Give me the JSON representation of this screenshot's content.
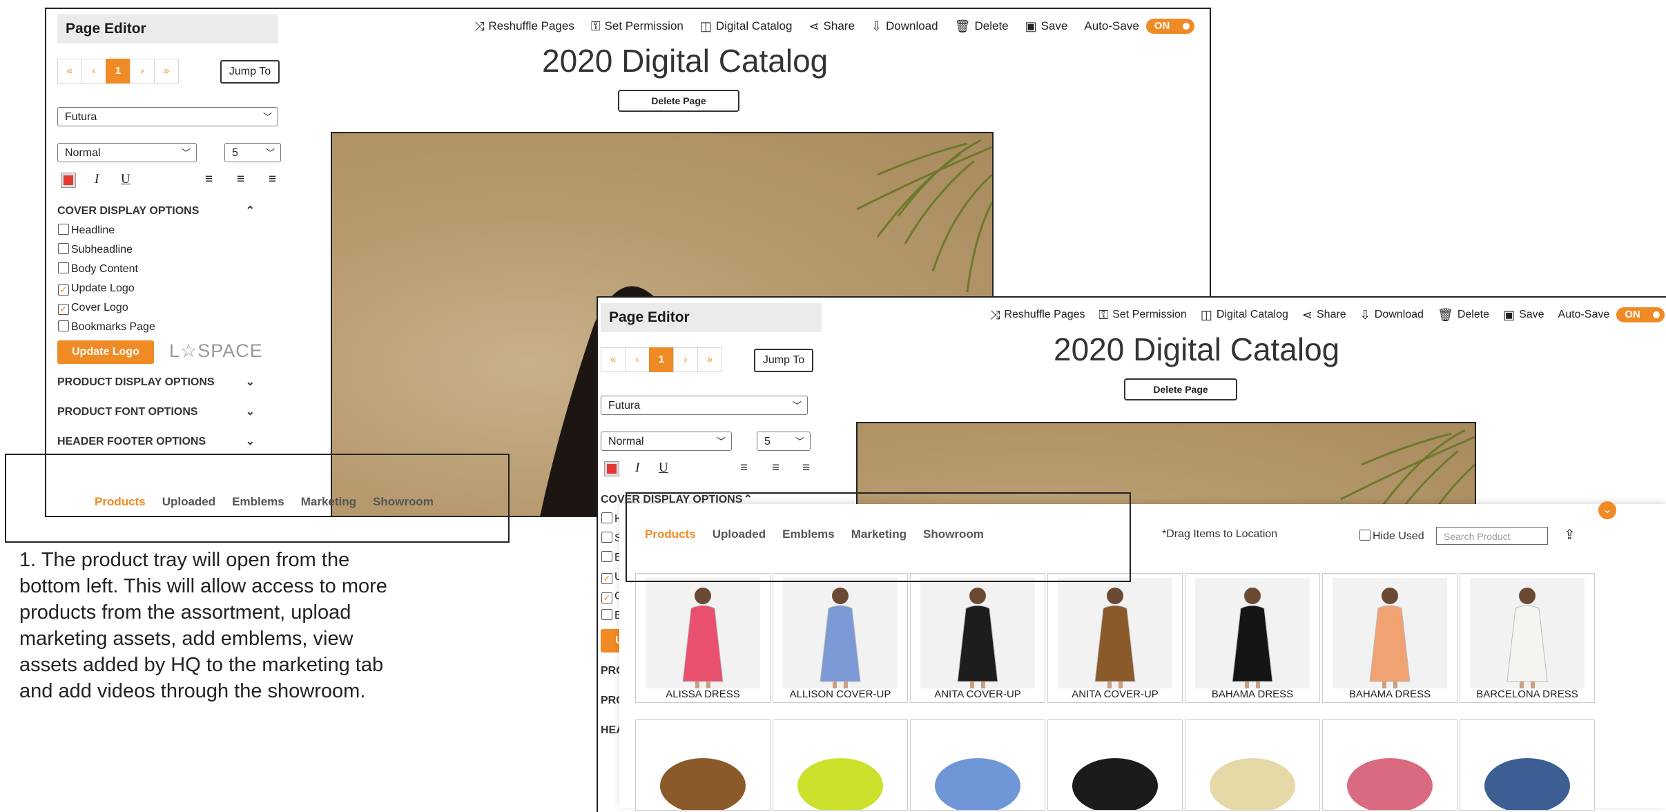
{
  "editor": {
    "sidebar_title": "Page Editor",
    "pager": [
      "«",
      "‹",
      "1",
      "›",
      "»"
    ],
    "jump_label": "Jump To",
    "font_value": "Futura",
    "style_value": "Normal",
    "size_value": "5",
    "sections": {
      "cover": "COVER DISPLAY OPTIONS",
      "product": "PRODUCT DISPLAY OPTIONS",
      "font": "PRODUCT FONT OPTIONS",
      "header": "HEADER FOOTER OPTIONS"
    },
    "cover_options": [
      {
        "label": "Headline",
        "checked": false
      },
      {
        "label": "Subheadline",
        "checked": false
      },
      {
        "label": "Body Content",
        "checked": false
      },
      {
        "label": "Update Logo",
        "checked": true
      },
      {
        "label": "Cover Logo",
        "checked": true
      },
      {
        "label": "Bookmarks Page",
        "checked": false
      }
    ],
    "update_logo_button": "Update Logo",
    "brand_logo": "L☆SPACE",
    "toolbar": {
      "reshuffle": "Reshuffle Pages",
      "permission": "Set Permission",
      "catalog": "Digital Catalog",
      "share": "Share",
      "download": "Download",
      "delete": "Delete",
      "save": "Save",
      "autosave": "Auto-Save",
      "toggle": "ON"
    },
    "catalog_title": "2020 Digital Catalog",
    "delete_page": "Delete Page"
  },
  "tray": {
    "tabs": [
      "Products",
      "Uploaded",
      "Emblems",
      "Marketing",
      "Showroom"
    ],
    "active_tab": "Products",
    "drag_hint": "*Drag Items to Location",
    "hide_used": "Hide Used",
    "search_placeholder": "Search Product",
    "products": [
      {
        "name": "ALISSA DRESS",
        "color": "#e8506e"
      },
      {
        "name": "ALLISON COVER-UP",
        "color": "#7b9ad6"
      },
      {
        "name": "ANITA COVER-UP",
        "color": "#1d1d1d"
      },
      {
        "name": "ANITA COVER-UP",
        "color": "#8a5a2b"
      },
      {
        "name": "BAHAMA DRESS",
        "color": "#151515"
      },
      {
        "name": "BAHAMA DRESS",
        "color": "#f0a273"
      },
      {
        "name": "BARCELONA DRESS",
        "color": "#f4f4f0"
      }
    ],
    "row2_colors": [
      "#8a5a2b",
      "#cde02b",
      "#6f97d8",
      "#1b1b1b",
      "#e6d9a8",
      "#d96a80",
      "#3c5e92"
    ]
  },
  "note": "1.  The product tray will open from the bottom left.  This will allow access to more products from the assortment, upload marketing assets, add emblems, view assets added by HQ to the marketing tab and add videos through the showroom.",
  "colors": {
    "accent": "#f08a25",
    "swatch": "#e53935"
  }
}
